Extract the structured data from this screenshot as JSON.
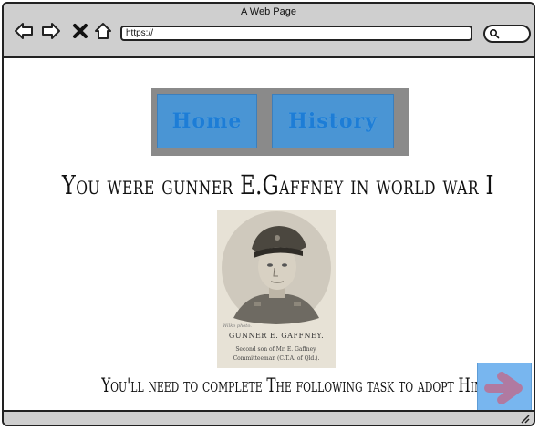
{
  "window": {
    "title": "A Web Page"
  },
  "toolbar": {
    "icons": [
      "back-arrow-icon",
      "forward-arrow-icon",
      "close-icon",
      "home-icon"
    ],
    "url": "https://",
    "search_icon": "search-icon"
  },
  "nav": {
    "home_label": "Home",
    "history_label": "History"
  },
  "main": {
    "heading": "You were gunner E.Gaffney in world war I",
    "photo": {
      "credit": "Wilko photo.",
      "name": "GUNNER E. GAFFNEY.",
      "caption_line1": "Second son of Mr. E. Gaffney,",
      "caption_line2": "Committeeman (C.T.A. of Qld.)."
    },
    "instruction": "You'll need to complete The following task to adopt Him",
    "next_icon": "right-arrow-icon"
  },
  "colors": {
    "chrome": "#cfcfcf",
    "nav_box": "#8a8a8a",
    "nav_tab": "#4a95d4",
    "nav_text": "#1d7dd6",
    "next_bg": "#78b6ef",
    "next_arrow": "#b07aa1"
  }
}
